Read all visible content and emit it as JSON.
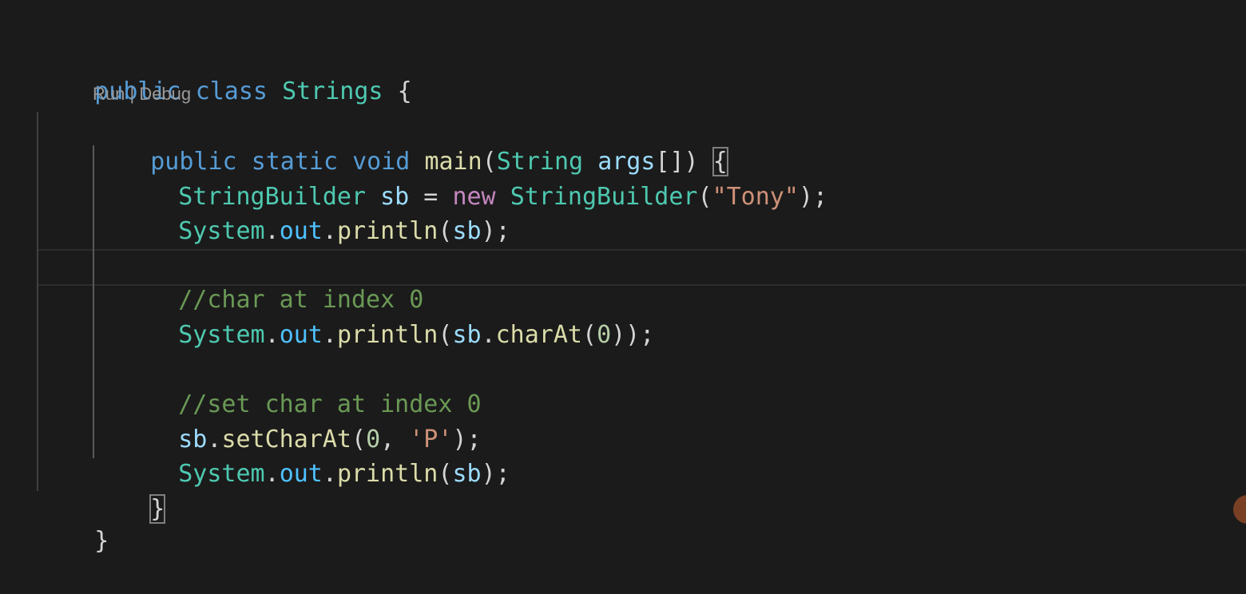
{
  "editor": {
    "codelens": {
      "run": "Run",
      "sep": " | ",
      "debug": "Debug"
    },
    "lines": {
      "l1": {
        "kw1": "public",
        "kw2": "class",
        "name": "Strings",
        "brace": "{"
      },
      "l2": {
        "kw1": "public",
        "kw2": "static",
        "kw3": "void",
        "fn": "main",
        "open": "(",
        "type": "String",
        "arg": "args",
        "tail": "[]) ",
        "brace": "{"
      },
      "l3": {
        "type": "StringBuilder",
        "var": "sb",
        "eq": " = ",
        "kw": "new",
        "ctor": "StringBuilder",
        "open": "(",
        "str": "\"Tony\"",
        "close": ");"
      },
      "l4": {
        "cls": "System",
        "dot1": ".",
        "field": "out",
        "dot2": ".",
        "fn": "println",
        "open": "(",
        "arg": "sb",
        "close": ");"
      },
      "l6": {
        "comment": "//char at index 0"
      },
      "l7": {
        "cls": "System",
        "dot1": ".",
        "field": "out",
        "dot2": ".",
        "fn": "println",
        "open": "(",
        "obj": "sb",
        "dot3": ".",
        "m": "charAt",
        "open2": "(",
        "num": "0",
        "close": "));"
      },
      "l9": {
        "comment": "//set char at index 0"
      },
      "l10": {
        "obj": "sb",
        "dot": ".",
        "m": "setCharAt",
        "open": "(",
        "num": "0",
        "comma": ", ",
        "chr": "'P'",
        "close": ");"
      },
      "l11": {
        "cls": "System",
        "dot1": ".",
        "field": "out",
        "dot2": ".",
        "fn": "println",
        "open": "(",
        "arg": "sb",
        "close": ");"
      },
      "l12": {
        "brace": "}"
      },
      "l13": {
        "brace": "}"
      }
    }
  }
}
